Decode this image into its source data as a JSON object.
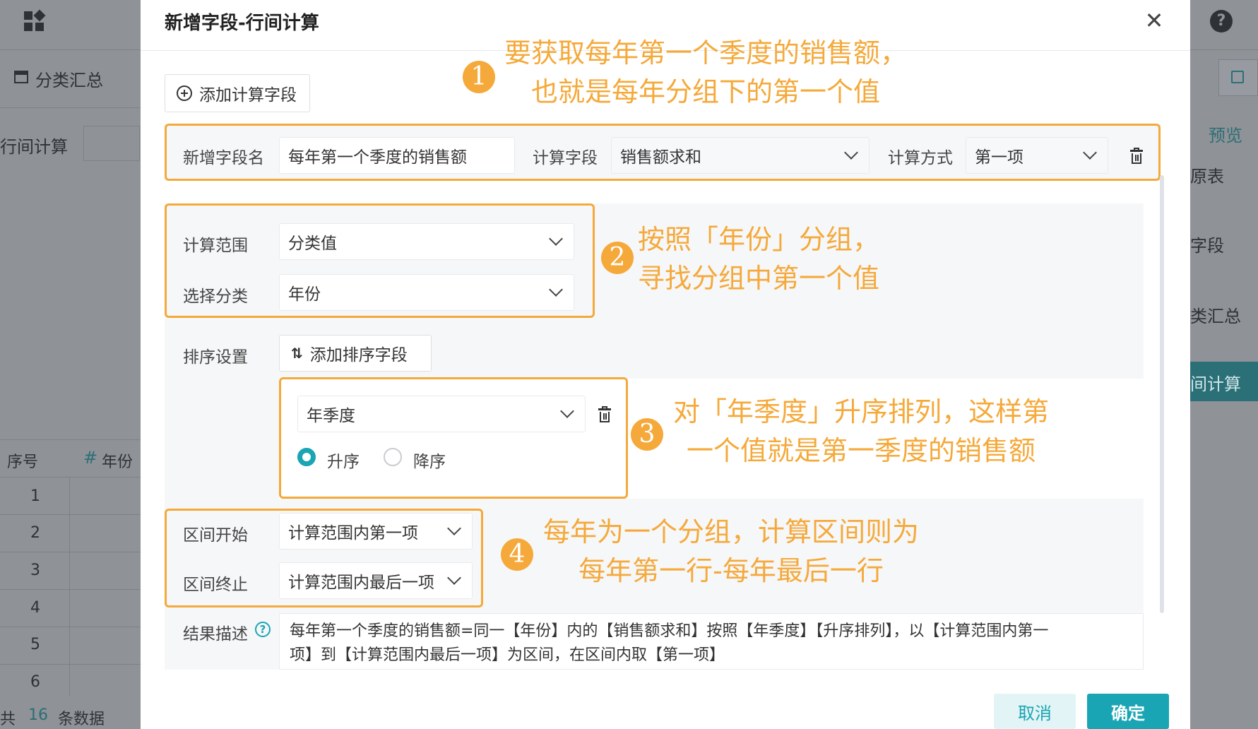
{
  "background": {
    "left_nav": {
      "category_summary": "分类汇总",
      "row_calc": "行间计算",
      "table_header_index": "序号",
      "table_header_year": "年份",
      "row_numbers": [
        "1",
        "2",
        "3",
        "4",
        "5",
        "6"
      ],
      "footer_prefix": "共",
      "footer_count": "16",
      "footer_suffix": "条数据"
    },
    "right_nav": {
      "preview": "预览",
      "source_table": "原表",
      "field": "字段",
      "category_summary": "类汇总",
      "row_calc": "间计算"
    }
  },
  "modal": {
    "title": "新增字段-行间计算",
    "add_calc_field_label": "添加计算字段",
    "row1": {
      "new_field_name_label": "新增字段名",
      "new_field_name_value": "每年第一个季度的销售额",
      "calc_field_label": "计算字段",
      "calc_field_value": "销售额求和",
      "calc_method_label": "计算方式",
      "calc_method_value": "第一项"
    },
    "scope": {
      "range_label": "计算范围",
      "range_value": "分类值",
      "category_label": "选择分类",
      "category_value": "年份"
    },
    "sort": {
      "label": "排序设置",
      "add_sort_label": "添加排序字段",
      "sort_field_value": "年季度",
      "asc_label": "升序",
      "desc_label": "降序",
      "selected": "asc"
    },
    "interval": {
      "start_label": "区间开始",
      "start_value": "计算范围内第一项",
      "end_label": "区间终止",
      "end_value": "计算范围内最后一项"
    },
    "result": {
      "label": "结果描述",
      "help": "?",
      "line1": "每年第一个季度的销售额=同一【年份】内的【销售额求和】按照【年季度】【升序排列】，以【计算范围内第一",
      "line2": "项】到【计算范围内最后一项】为区间，在区间内取【第一项】"
    },
    "cancel_label": "取消",
    "ok_label": "确定"
  },
  "annotations": [
    {
      "badge": "1",
      "line1": "要获取每年第一个季度的销售额，",
      "line2": "也就是每年分组下的第一个值"
    },
    {
      "badge": "2",
      "line1": "按照「年份」分组，",
      "line2": "寻找分组中第一个值"
    },
    {
      "badge": "3",
      "line1": "对「年季度」升序排列，这样第",
      "line2": "一个值就是第一季度的销售额"
    },
    {
      "badge": "4",
      "line1": "每年为一个分组，计算区间则为",
      "line2": "每年第一行-每年最后一行"
    }
  ],
  "colors": {
    "accent": "#1aa5b4",
    "annotation": "#f5a93a"
  }
}
